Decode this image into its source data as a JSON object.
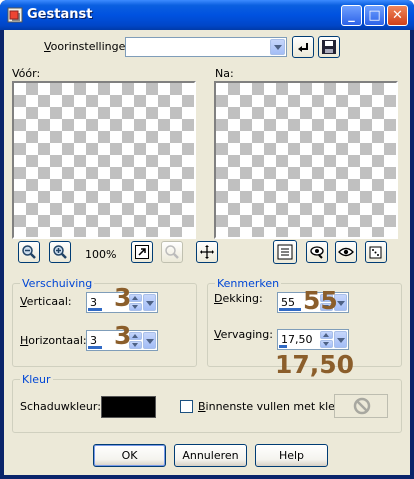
{
  "window": {
    "title": "Gestanst",
    "minimize": "_",
    "maximize": "□",
    "close": "✕"
  },
  "presets": {
    "label_prefix": "V",
    "label_rest": "oorinstellingen:",
    "value": ""
  },
  "previews": {
    "before_label": "Vóór:",
    "after_label": "Na:"
  },
  "zoom": {
    "level": "100%"
  },
  "offset": {
    "title": "Verschuiving",
    "vertical_label_prefix": "V",
    "vertical_label_rest": "erticaal:",
    "vertical_value": "3",
    "vertical_level": 0.35,
    "horizontal_label_prefix": "H",
    "horizontal_label_rest": "orizontaal:",
    "horizontal_value": "3",
    "horizontal_level": 0.35,
    "vertical_overlay": "3",
    "horizontal_overlay": "3"
  },
  "attributes": {
    "title": "Kenmerken",
    "opacity_label_prefix": "D",
    "opacity_label_rest": "ekking:",
    "opacity_value": "55",
    "opacity_level": 0.55,
    "opacity_overlay": "55",
    "blur_label_prefix": "V",
    "blur_label_rest": "ervaging:",
    "blur_value": "17,50",
    "blur_level": 0.2,
    "blur_overlay": "17,50"
  },
  "color": {
    "title": "Kleur",
    "shadow_label": "Schaduwkleur:",
    "shadow_color": "#000000",
    "fill_inside_prefix": "B",
    "fill_inside_rest": "innenste vullen met kleur:",
    "fill_inside_checked": false
  },
  "buttons": {
    "ok": "OK",
    "cancel": "Annuleren",
    "help": "Help"
  },
  "icons": {
    "app": "drop-shadow-icon",
    "reset": "reset-arrow-icon",
    "save": "floppy-disk-icon",
    "zoom_out": "zoom-out-icon",
    "zoom_in": "zoom-in-icon",
    "fit": "fit-to-window-icon",
    "zoom_disabled": "zoom-actual-icon",
    "pan": "pan-move-icon",
    "proof": "proof-icon",
    "randomize": "dice-icon"
  }
}
